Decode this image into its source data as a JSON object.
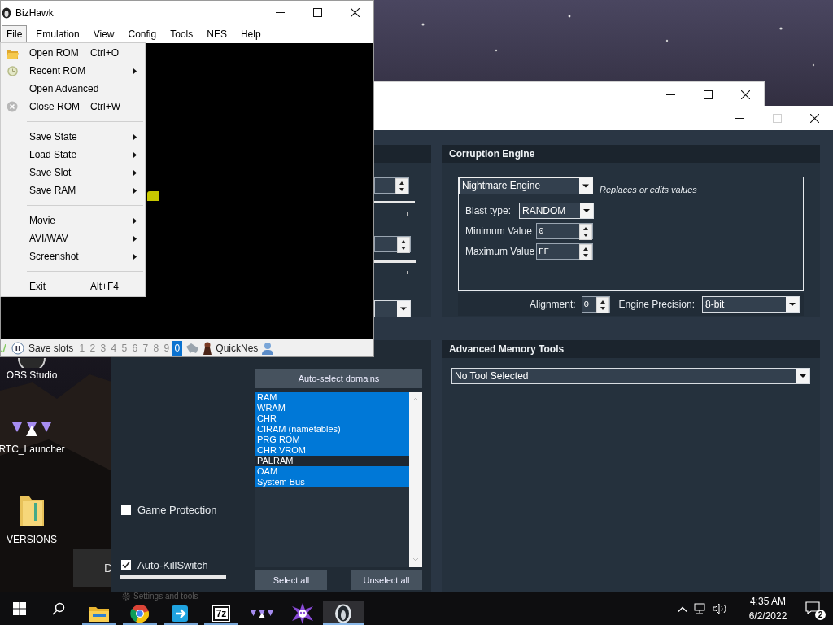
{
  "desktop_icons": [
    {
      "label": "OBS Studio",
      "kind": "obs"
    },
    {
      "label": "RTC_Launcher",
      "kind": "launcher"
    },
    {
      "label": "VERSIONS",
      "kind": "folder"
    }
  ],
  "background_window": {
    "partial_label": "D"
  },
  "rtc_window": {
    "maximize_enabled": false,
    "corruption_engine": {
      "title": "Corruption Engine",
      "engine": "Nightmare Engine",
      "description": "Replaces or edits values",
      "fields": [
        {
          "kind": "dropdown",
          "label": "Blast type:",
          "value": "RANDOM"
        },
        {
          "kind": "spinner",
          "label": "Minimum Value",
          "value": "0"
        },
        {
          "kind": "spinner",
          "label": "Maximum Value",
          "value": "FF"
        }
      ],
      "alignment": {
        "label": "Alignment:",
        "value": "0"
      },
      "precision": {
        "label": "Engine Precision:",
        "value": "8-bit"
      }
    },
    "checkboxes": [
      {
        "label": "Game Protection",
        "checked": false
      },
      {
        "label": "Auto-KillSwitch",
        "checked": true
      }
    ],
    "domains": {
      "button": "Auto-select domains",
      "items": [
        {
          "label": "RAM",
          "selected": true
        },
        {
          "label": "WRAM",
          "selected": true
        },
        {
          "label": "CHR",
          "selected": true
        },
        {
          "label": "CIRAM (nametables)",
          "selected": true
        },
        {
          "label": "PRG ROM",
          "selected": true
        },
        {
          "label": "CHR VROM",
          "selected": true
        },
        {
          "label": "PALRAM",
          "selected": false
        },
        {
          "label": "OAM",
          "selected": true
        },
        {
          "label": "System Bus",
          "selected": true
        }
      ],
      "buttons": [
        "Select all",
        "Unselect all"
      ]
    },
    "memory_tools": {
      "title": "Advanced Memory Tools",
      "tool": "No Tool Selected"
    }
  },
  "bizhawk": {
    "title": "BizHawk",
    "menu": [
      {
        "label": "File",
        "selected": true
      },
      {
        "label": "Emulation",
        "selected": false
      },
      {
        "label": "View",
        "selected": false
      },
      {
        "label": "Config",
        "selected": false
      },
      {
        "label": "Tools",
        "selected": false
      },
      {
        "label": "NES",
        "selected": false
      },
      {
        "label": "Help",
        "selected": false
      }
    ],
    "file_menu": [
      [
        {
          "label": "Open ROM",
          "shortcut": "Ctrl+O",
          "submenu": false,
          "kind": "folder"
        },
        {
          "label": "Recent ROM",
          "submenu": true,
          "kind": "clock"
        },
        {
          "label": "Open Advanced",
          "submenu": false,
          "kind": "plain"
        },
        {
          "label": "Close ROM",
          "shortcut": "Ctrl+W",
          "submenu": false,
          "kind": "close"
        }
      ],
      [
        {
          "label": "Save State",
          "submenu": true,
          "kind": "plain"
        },
        {
          "label": "Load State",
          "submenu": true,
          "kind": "plain"
        },
        {
          "label": "Save Slot",
          "submenu": true,
          "kind": "plain"
        },
        {
          "label": "Save RAM",
          "submenu": true,
          "kind": "plain"
        }
      ],
      [
        {
          "label": "Movie",
          "submenu": true,
          "kind": "plain"
        },
        {
          "label": "AVI/WAV",
          "submenu": true,
          "kind": "plain"
        },
        {
          "label": "Screenshot",
          "submenu": true,
          "kind": "plain"
        }
      ],
      [
        {
          "label": "Exit",
          "shortcut": "Alt+F4",
          "submenu": false,
          "kind": "plain"
        }
      ]
    ],
    "status_bar": {
      "label": "Save slots",
      "slots": [
        {
          "label": "1",
          "selected": false
        },
        {
          "label": "2",
          "selected": false
        },
        {
          "label": "3",
          "selected": false
        },
        {
          "label": "4",
          "selected": false
        },
        {
          "label": "5",
          "selected": false
        },
        {
          "label": "6",
          "selected": false
        },
        {
          "label": "7",
          "selected": false
        },
        {
          "label": "8",
          "selected": false
        },
        {
          "label": "9",
          "selected": false
        },
        {
          "label": "0",
          "selected": true
        }
      ],
      "core": "QuickNes"
    }
  },
  "taskbar": {
    "ghost_text": "Settings and tools",
    "apps": [
      {
        "kind": "files",
        "running": true,
        "active": false
      },
      {
        "kind": "browser",
        "running": true,
        "active": false
      },
      {
        "kind": "transfer",
        "running": true,
        "active": false
      },
      {
        "kind": "archive",
        "glyph": "7z",
        "running": true,
        "active": false
      },
      {
        "kind": "launcher",
        "running": false,
        "active": false
      },
      {
        "kind": "spark",
        "running": false,
        "active": false
      },
      {
        "kind": "bizhawk",
        "running": true,
        "active": true
      }
    ],
    "time": "4:35 AM",
    "date": "6/2/2022",
    "notifications": "2"
  }
}
